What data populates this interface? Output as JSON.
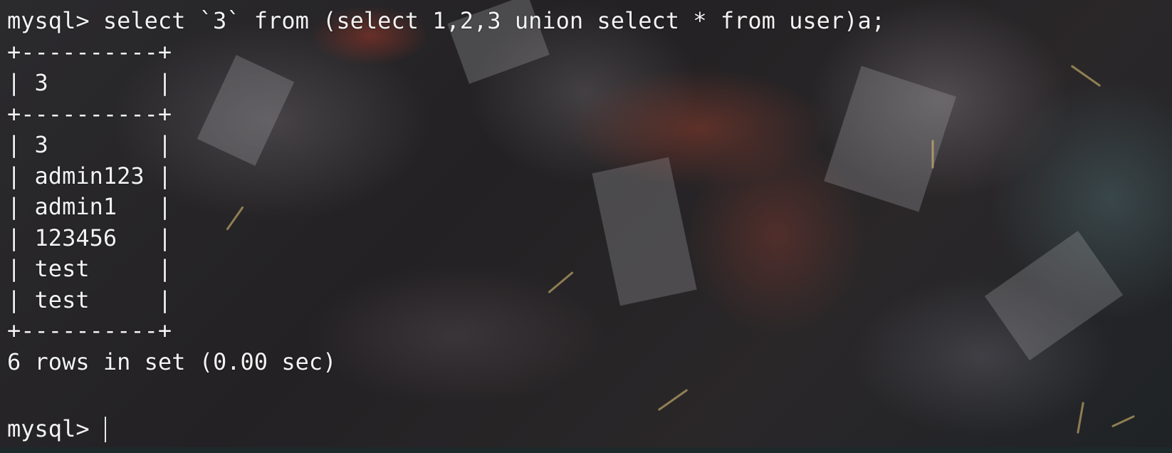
{
  "terminal": {
    "prompt": "mysql>",
    "command": "select `3` from (select 1,2,3 union select * from user)a;",
    "table": {
      "border": "+----------+",
      "header": "3",
      "rows": [
        "3",
        "admin123",
        "admin1",
        "123456",
        "test",
        "test"
      ]
    },
    "result_summary": "6 rows in set (0.00 sec)",
    "current_input": ""
  },
  "colors": {
    "text": "#f2f2f2",
    "background": "#1c1a1c"
  }
}
